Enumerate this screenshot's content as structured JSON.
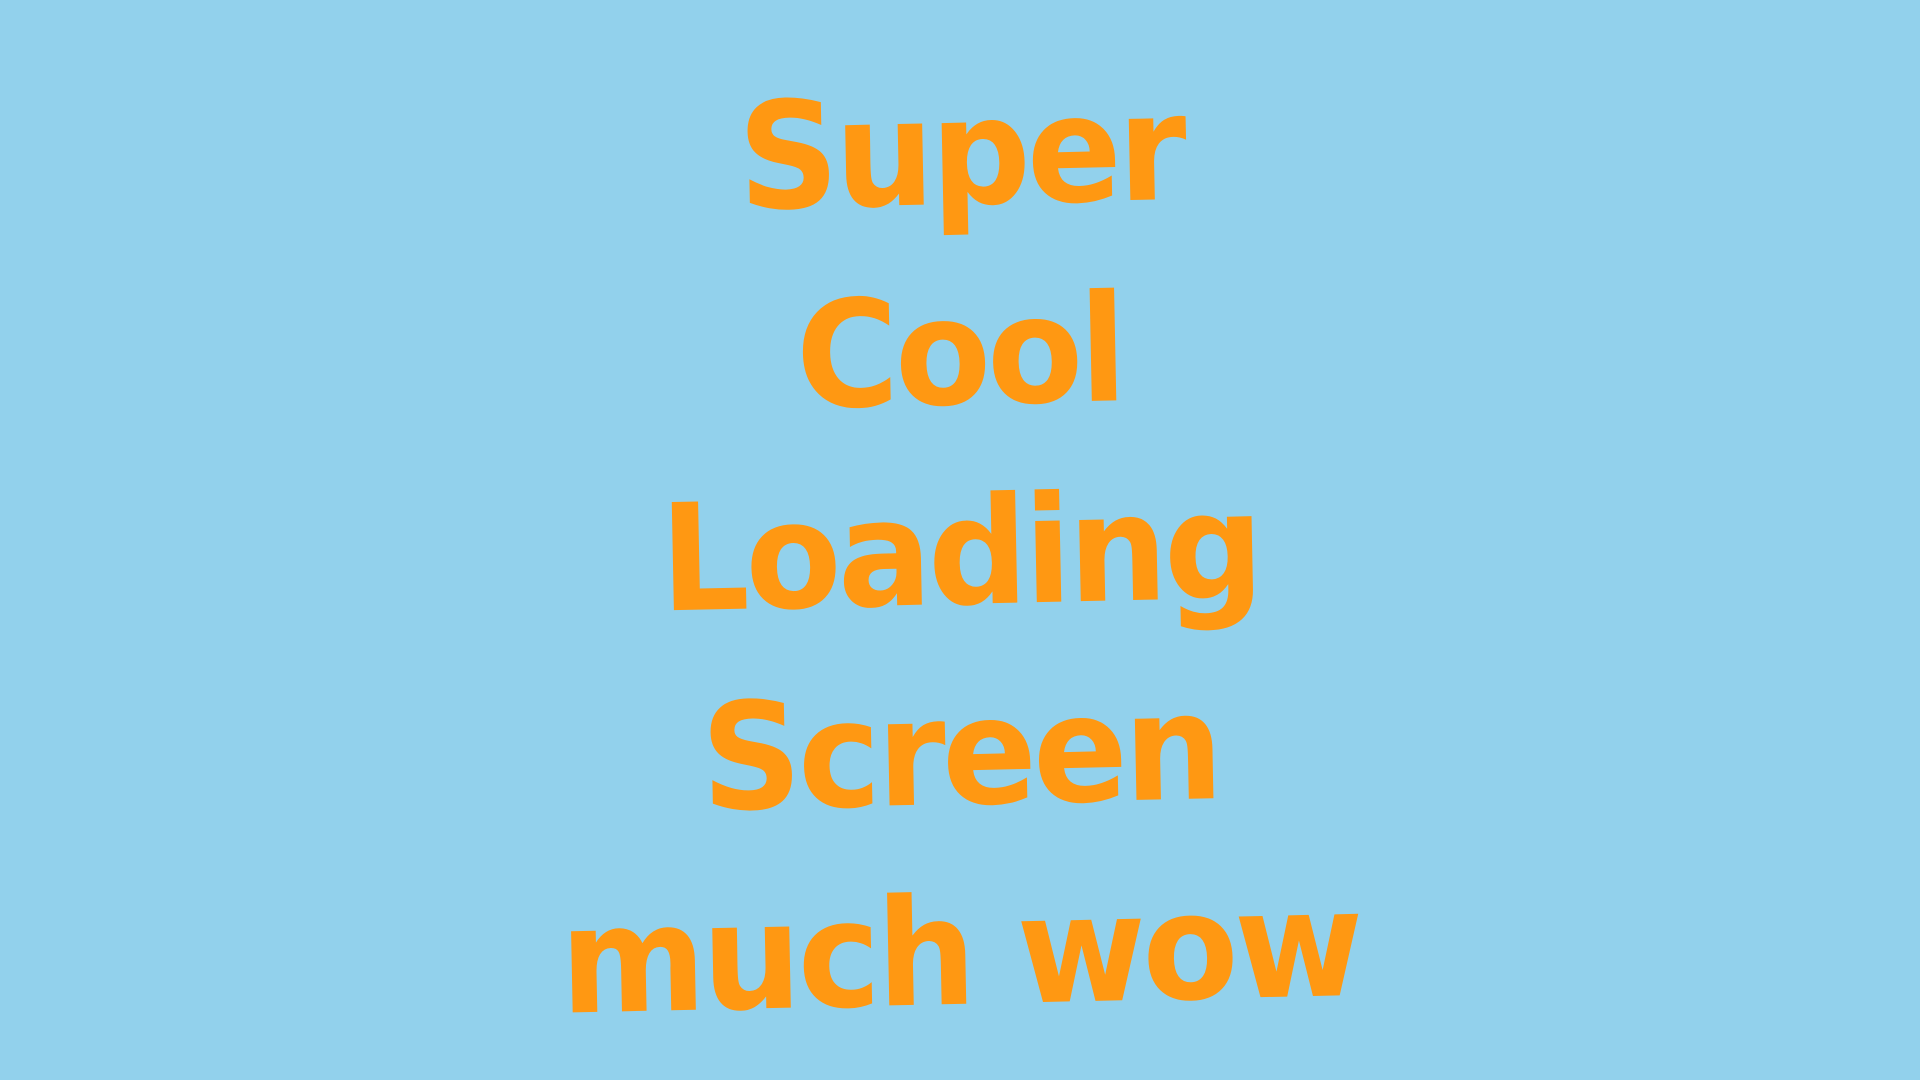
{
  "loading_screen": {
    "background_color": "#92d1ec",
    "text_color": "#ff9812",
    "title_lines": [
      "Super",
      "Cool",
      "Loading",
      "Screen",
      "much wow"
    ]
  }
}
